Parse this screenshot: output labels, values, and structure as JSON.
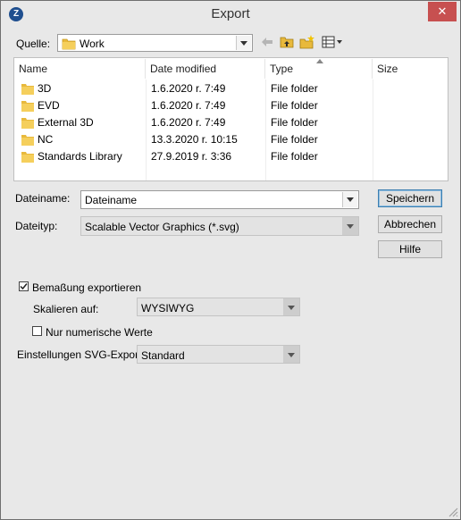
{
  "window": {
    "title": "Export"
  },
  "location": {
    "label": "Quelle:",
    "value": "Work",
    "icons": [
      "folder-icon",
      "back-arrow-icon",
      "up-folder-icon",
      "new-folder-icon",
      "view-menu-icon"
    ]
  },
  "file_list": {
    "columns": [
      "Name",
      "Date modified",
      "Type",
      "Size"
    ],
    "rows": [
      {
        "name": "3D",
        "date": "1.6.2020 r. 7:49",
        "type": "File folder"
      },
      {
        "name": "EVD",
        "date": "1.6.2020 r. 7:49",
        "type": "File folder"
      },
      {
        "name": "External 3D",
        "date": "1.6.2020 r. 7:49",
        "type": "File folder"
      },
      {
        "name": "NC",
        "date": "13.3.2020 r. 10:15",
        "type": "File folder"
      },
      {
        "name": "Standards Library",
        "date": "27.9.2019 r. 3:36",
        "type": "File folder"
      }
    ]
  },
  "filename": {
    "label": "Dateiname:",
    "value": "Dateiname"
  },
  "filetype": {
    "label": "Dateityp:",
    "value": "Scalable Vector Graphics (*.svg)"
  },
  "buttons": {
    "save": "Speichern",
    "cancel": "Abbrechen",
    "help": "Hilfe"
  },
  "options": {
    "export_dimensions": {
      "label": "Bemaßung exportieren",
      "checked": true
    },
    "scale": {
      "label": "Skalieren auf:",
      "value": "WYSIWYG"
    },
    "numeric_only": {
      "label": "Nur numerische Werte",
      "checked": false
    },
    "svg_settings": {
      "label": "Einstellungen SVG-Export:",
      "value": "Standard"
    }
  },
  "colors": {
    "accent": "#3c7fb1",
    "close": "#c75050",
    "folder": "#e8b93c"
  }
}
